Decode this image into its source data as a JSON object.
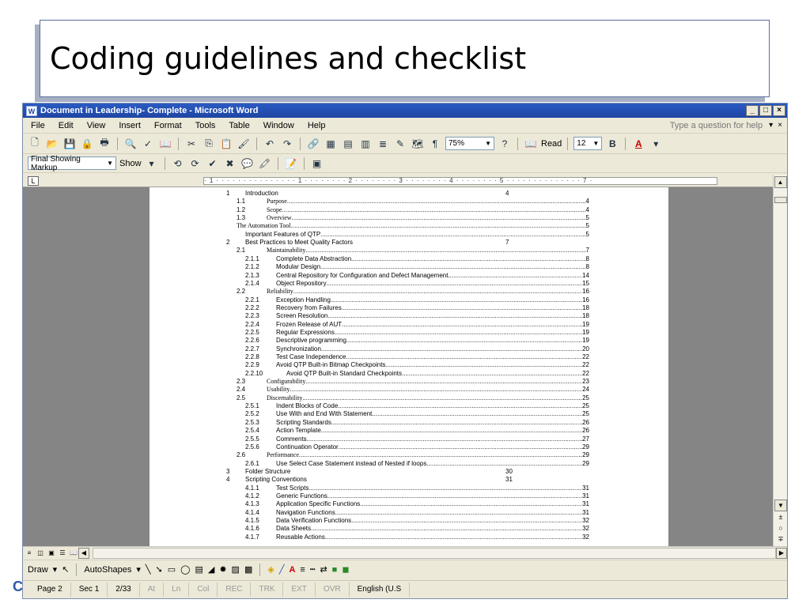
{
  "slide": {
    "title": "Coding guidelines and checklist",
    "corner_letter": "C"
  },
  "window": {
    "title": "Document in Leadership- Complete - Microsoft Word",
    "app_icon": "W",
    "min": "_",
    "max": "□",
    "close": "×"
  },
  "menu": {
    "items": [
      "File",
      "Edit",
      "View",
      "Insert",
      "Format",
      "Tools",
      "Table",
      "Window",
      "Help"
    ],
    "help_box": "Type a question for help",
    "help_close": "×"
  },
  "toolbar": {
    "zoom": "75%",
    "read": "Read",
    "font_size": "12",
    "bold": "B",
    "font_color": "A"
  },
  "toolbar2": {
    "markup": "Final Showing Markup",
    "show": "Show"
  },
  "ruler": {
    "marks": "· 1 · · · · · · · · · · · · · · · 1 · · · · · · · · 2 · · · · · · · · 3 · · · · · · · · 4 · · · · · · · · 5 · · · · · · · · · · · · · · 7 ·"
  },
  "toc": [
    {
      "num": "1",
      "text": "Introduction",
      "page": "4",
      "style": "h1"
    },
    {
      "num": "1.1",
      "text": "Purpose",
      "page": "4",
      "style": "h2"
    },
    {
      "num": "1.2",
      "text": "Scope",
      "page": "4",
      "style": "h2"
    },
    {
      "num": "1.3",
      "text": "Overview",
      "page": "5",
      "style": "h2"
    },
    {
      "num": "",
      "text": "The Automation Tool",
      "page": "5",
      "style": "h0"
    },
    {
      "num": "",
      "text": "Important Features of QTP",
      "page": "5",
      "style": "h1b"
    },
    {
      "num": "2",
      "text": "Best Practices to Meet Quality Factors",
      "page": "7",
      "style": "h1"
    },
    {
      "num": "2.1",
      "text": "Maintainability",
      "page": "7",
      "style": "h2"
    },
    {
      "num": "2.1.1",
      "text": "Complete Data Abstraction",
      "page": "8",
      "style": "h3"
    },
    {
      "num": "2.1.2",
      "text": "Modular Design",
      "page": "8",
      "style": "h3"
    },
    {
      "num": "2.1.3",
      "text": "Central Repository for Configuration and Defect Management",
      "page": "14",
      "style": "h3"
    },
    {
      "num": "2.1.4",
      "text": "Object Repository",
      "page": "15",
      "style": "h3"
    },
    {
      "num": "2.2",
      "text": "Reliability",
      "page": "16",
      "style": "h2"
    },
    {
      "num": "2.2.1",
      "text": "Exception Handling",
      "page": "16",
      "style": "h3"
    },
    {
      "num": "2.2.2",
      "text": "Recovery from Failures",
      "page": "18",
      "style": "h3"
    },
    {
      "num": "2.2.3",
      "text": "Screen Resolution",
      "page": "18",
      "style": "h3"
    },
    {
      "num": "2.2.4",
      "text": "Frozen Release of AUT",
      "page": "19",
      "style": "h3"
    },
    {
      "num": "2.2.5",
      "text": "Regular Expressions",
      "page": "19",
      "style": "h3"
    },
    {
      "num": "2.2.6",
      "text": "Descriptive programming",
      "page": "19",
      "style": "h3"
    },
    {
      "num": "2.2.7",
      "text": "Synchronization",
      "page": "20",
      "style": "h3"
    },
    {
      "num": "2.2.8",
      "text": "Test Case Independence",
      "page": "22",
      "style": "h3"
    },
    {
      "num": "2.2.9",
      "text": "Avoid QTP Built-in Bitmap Checkpoints",
      "page": "22",
      "style": "h3"
    },
    {
      "num": "2.2.10",
      "text": "Avoid QTP Built-in Standard Checkpoints",
      "page": "22",
      "style": "h3w"
    },
    {
      "num": "2.3",
      "text": "Configurability",
      "page": "23",
      "style": "h2"
    },
    {
      "num": "2.4",
      "text": "Usability",
      "page": "24",
      "style": "h2"
    },
    {
      "num": "2.5",
      "text": "Discernability",
      "page": "25",
      "style": "h2"
    },
    {
      "num": "2.5.1",
      "text": "Indent Blocks of Code",
      "page": "25",
      "style": "h3"
    },
    {
      "num": "2.5.2",
      "text": "Use With and End With Statement",
      "page": "25",
      "style": "h3"
    },
    {
      "num": "2.5.3",
      "text": "Scripting Standards",
      "page": "26",
      "style": "h3"
    },
    {
      "num": "2.5.4",
      "text": "Action Template",
      "page": "26",
      "style": "h3"
    },
    {
      "num": "2.5.5",
      "text": "Comments",
      "page": "27",
      "style": "h3"
    },
    {
      "num": "2.5.6",
      "text": "Continuation Operator",
      "page": "29",
      "style": "h3"
    },
    {
      "num": "2.6",
      "text": "Performance",
      "page": "29",
      "style": "h2"
    },
    {
      "num": "2.6.1",
      "text": "Use Select Case Statement instead of Nested if loops",
      "page": "29",
      "style": "h3"
    },
    {
      "num": "3",
      "text": "Folder Structure",
      "page": "30",
      "style": "h1"
    },
    {
      "num": "4",
      "text": "Scripting Conventions",
      "page": "31",
      "style": "h1"
    },
    {
      "num": "4.1.1",
      "text": "Test Scripts",
      "page": "31",
      "style": "h3"
    },
    {
      "num": "4.1.2",
      "text": "Generic Functions",
      "page": "31",
      "style": "h3"
    },
    {
      "num": "4.1.3",
      "text": "Application Specific Functions",
      "page": "31",
      "style": "h3"
    },
    {
      "num": "4.1.4",
      "text": "Navigation Functions",
      "page": "31",
      "style": "h3"
    },
    {
      "num": "4.1.5",
      "text": "Data Verification Functions",
      "page": "32",
      "style": "h3"
    },
    {
      "num": "4.1.6",
      "text": "Data Sheets",
      "page": "32",
      "style": "h3"
    },
    {
      "num": "4.1.7",
      "text": "Reusable Actions",
      "page": "32",
      "style": "h3"
    }
  ],
  "drawbar": {
    "draw": "Draw",
    "autoshapes": "AutoShapes"
  },
  "status": {
    "page": "Page 2",
    "sec": "Sec 1",
    "pages": "2/33",
    "at": "At",
    "ln": "Ln",
    "col": "Col",
    "rec": "REC",
    "trk": "TRK",
    "ext": "EXT",
    "ovr": "OVR",
    "lang": "English (U.S"
  }
}
